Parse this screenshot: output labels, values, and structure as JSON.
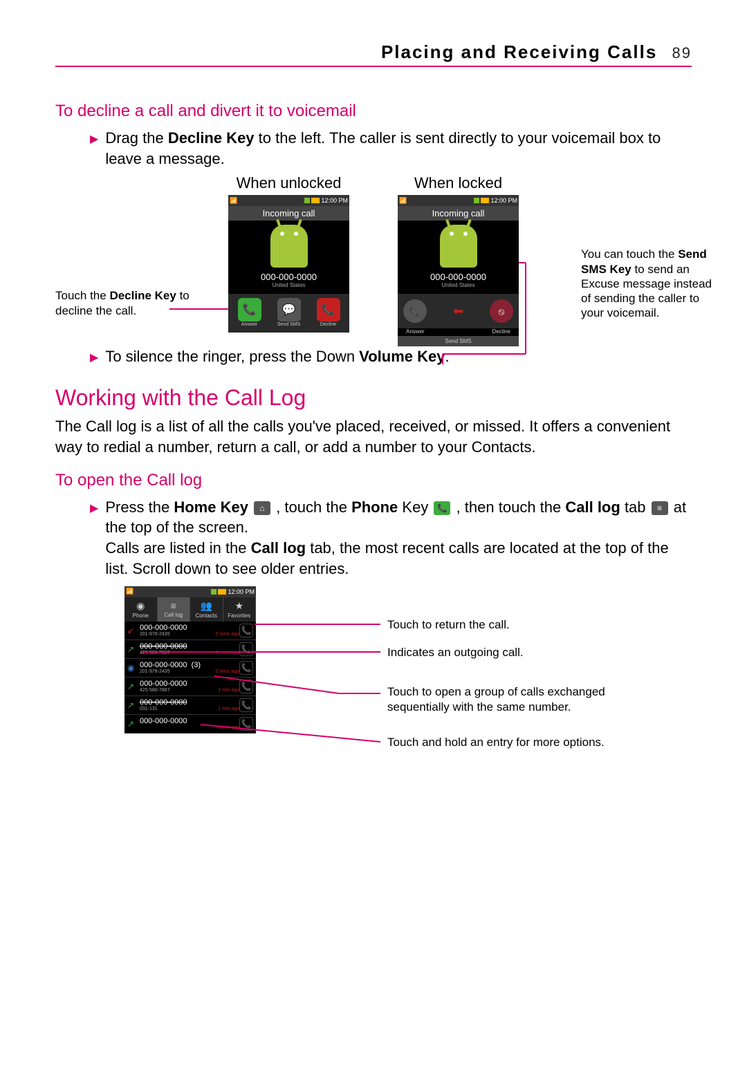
{
  "header": {
    "title": "Placing and Receiving Calls",
    "page_number": "89"
  },
  "section1": {
    "heading": "To decline a call and divert it to voicemail",
    "bullet1_pre": "Drag the ",
    "bullet1_key": "Decline Key",
    "bullet1_post": " to the left. The caller is sent directly to your voicemail box to leave a message.",
    "cap_unlocked": "When unlocked",
    "cap_locked": "When locked",
    "bullet2_pre": "To silence the ringer, press the Down ",
    "bullet2_key": "Volume Key",
    "bullet2_post": "."
  },
  "incoming_screens": {
    "status_time": "12:00 PM",
    "title": "Incoming call",
    "number": "000-000-0000",
    "location": "United States",
    "btn_answer": "Answer",
    "btn_sendsms": "Send SMS",
    "btn_decline": "Decline"
  },
  "annot_left": {
    "l1": "Touch the ",
    "l2_key": "Decline Key",
    "l3": " to decline the call."
  },
  "annot_right": {
    "l1": "You can touch the ",
    "l2_key": "Send SMS Key",
    "l3": " to send an Excuse message instead of sending the caller to your voicemail."
  },
  "section2": {
    "heading": "Working with the Call Log",
    "para": "The Call log is a list of all the calls you've placed, received, or missed. It offers a convenient way to redial a number, return a call, or add a number to your Contacts."
  },
  "section3": {
    "heading": "To open the Call log",
    "b1_a": "Press the ",
    "b1_home": "Home Key",
    "b1_b": " , touch the ",
    "b1_phone": "Phone",
    "b1_c": " Key , then touch the ",
    "b1_calllog": "Call log",
    "b1_d": " tab  at the top of the screen.",
    "b2_a": "Calls are listed in the ",
    "b2_calllog": "Call log",
    "b2_b": " tab, the most recent calls are located at the top of the list. Scroll down to see older entries."
  },
  "calllog_screen": {
    "status_time": "12:00 PM",
    "tabs": [
      "Phone",
      "Call log",
      "Contacts",
      "Favorites"
    ],
    "rows": [
      {
        "icon": "missed",
        "num": "000-000-0000",
        "count": "",
        "sub": "201-978-2435",
        "time": "0 mins ago",
        "strike": false
      },
      {
        "icon": "out",
        "num": "000-000-0000",
        "count": "",
        "sub": "425-580-7887",
        "time": "0 mins ago",
        "strike": true
      },
      {
        "icon": "in",
        "num": "000-000-0000",
        "count": "(3)",
        "sub": "201-978-2435",
        "time": "0 mins ago",
        "strike": false
      },
      {
        "icon": "out",
        "num": "000-000-0000",
        "count": "",
        "sub": "425-580-7887",
        "time": "1 min ago",
        "strike": false
      },
      {
        "icon": "out",
        "num": "000-000-0000",
        "count": "",
        "sub": "031-131",
        "time": "1 min ago",
        "strike": true
      },
      {
        "icon": "out",
        "num": "000-000-0000",
        "count": "",
        "sub": "",
        "time": "1 min ago",
        "strike": false
      }
    ]
  },
  "calllog_annots": {
    "a1": "Touch to return the call.",
    "a2": "Indicates an outgoing call.",
    "a3": "Touch to open a group of calls exchanged sequentially with the same number.",
    "a4": "Touch and hold an entry for more options."
  },
  "colors": {
    "accent": "#d6006c"
  }
}
